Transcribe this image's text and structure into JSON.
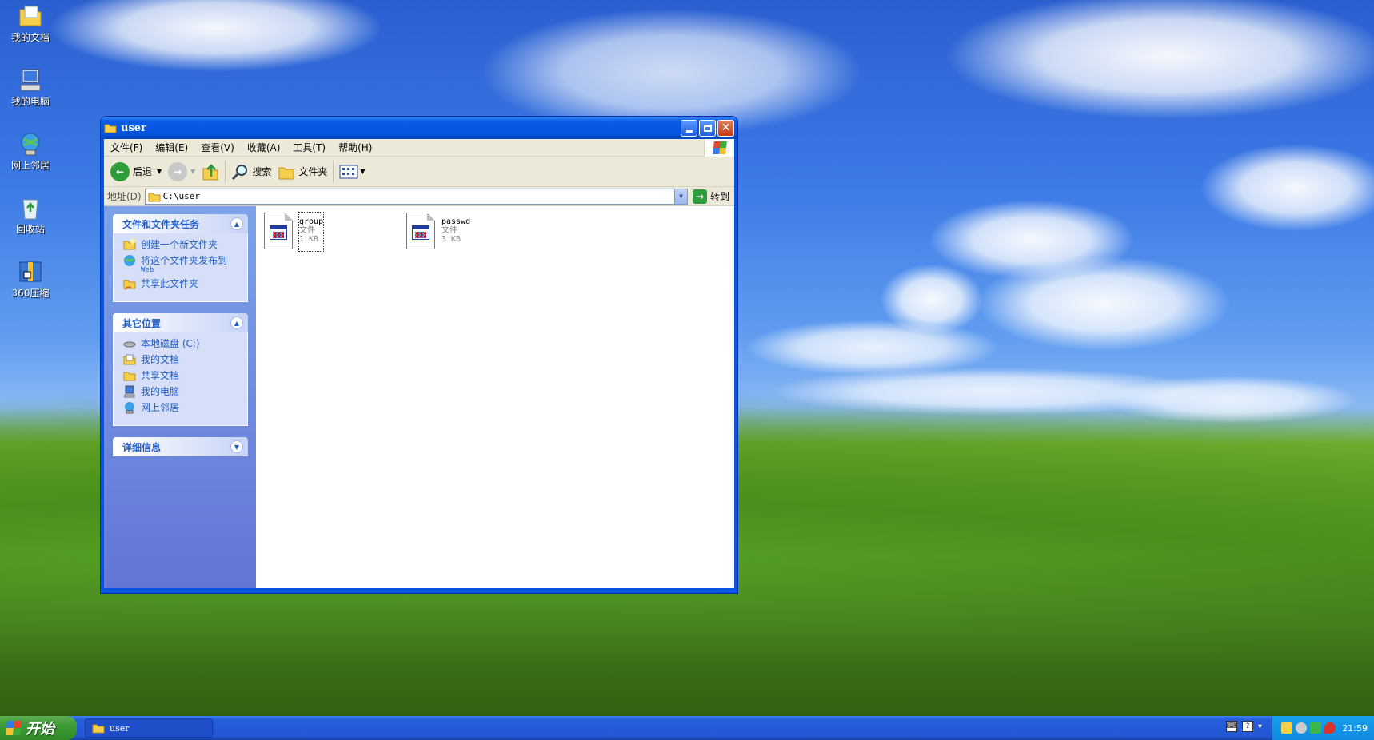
{
  "desktop": {
    "icons": [
      {
        "label": "我的文档",
        "icon": "my-documents-icon"
      },
      {
        "label": "我的电脑",
        "icon": "my-computer-icon"
      },
      {
        "label": "网上邻居",
        "icon": "network-places-icon"
      },
      {
        "label": "回收站",
        "icon": "recycle-bin-icon"
      },
      {
        "label": "360压缩",
        "icon": "360-zip-icon"
      }
    ]
  },
  "window": {
    "title": "user",
    "menu": [
      "文件(F)",
      "编辑(E)",
      "查看(V)",
      "收藏(A)",
      "工具(T)",
      "帮助(H)"
    ],
    "toolbar": {
      "back": "后退",
      "search": "搜索",
      "folders": "文件夹"
    },
    "address": {
      "label": "地址(D)",
      "value": "C:\\user",
      "go": "转到"
    },
    "tasks_panel": {
      "title": "文件和文件夹任务",
      "items": [
        {
          "label": "创建一个新文件夹",
          "icon": "new-folder-icon"
        },
        {
          "label": "将这个文件夹发布到",
          "sub": "Web",
          "icon": "publish-web-icon"
        },
        {
          "label": "共享此文件夹",
          "icon": "share-folder-icon"
        }
      ]
    },
    "places_panel": {
      "title": "其它位置",
      "items": [
        {
          "label": "本地磁盘 (C:)",
          "icon": "local-disk-icon"
        },
        {
          "label": "我的文档",
          "icon": "my-documents-icon"
        },
        {
          "label": "共享文档",
          "icon": "shared-documents-icon"
        },
        {
          "label": "我的电脑",
          "icon": "my-computer-icon"
        },
        {
          "label": "网上邻居",
          "icon": "network-places-icon"
        }
      ]
    },
    "details_panel": {
      "title": "详细信息"
    },
    "files": [
      {
        "name": "group",
        "type": "文件",
        "size": "1 KB",
        "selected": true
      },
      {
        "name": "passwd",
        "type": "文件",
        "size": "3 KB",
        "selected": false
      }
    ]
  },
  "taskbar": {
    "start": "开始",
    "tasks": [
      "user"
    ],
    "clock": "21:59"
  },
  "colors": {
    "title_blue": "#0a54e3",
    "link_blue": "#215dc6",
    "pane_bg": "#7ba2e7",
    "taskbar_blue": "#245edb",
    "start_green": "#3c9c34"
  }
}
